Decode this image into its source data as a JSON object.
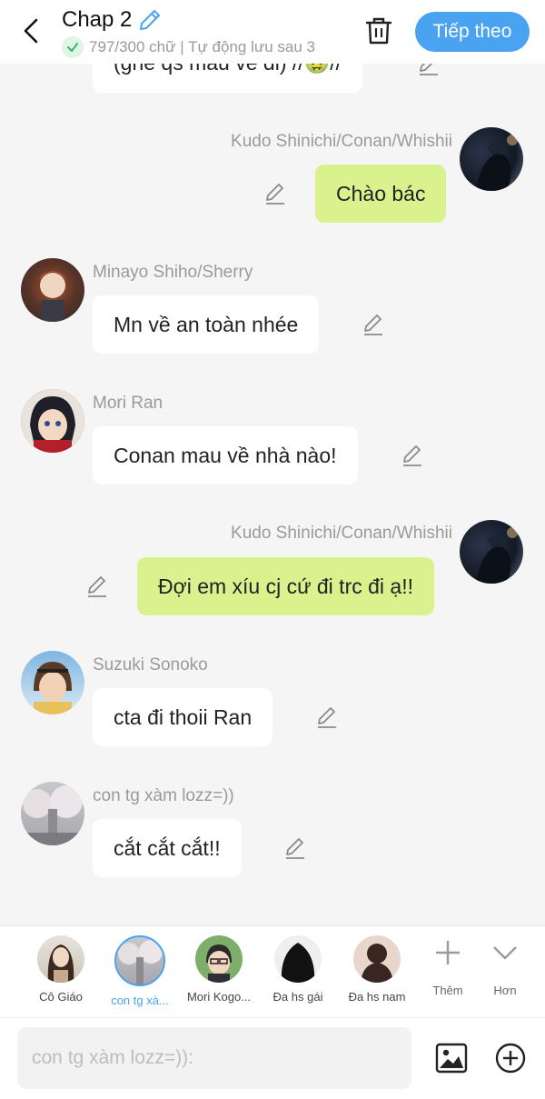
{
  "header": {
    "title": "Chap 2",
    "subtitle": "797/300 chữ | Tự động lưu sau 3",
    "next_label": "Tiếp theo"
  },
  "messages": [
    {
      "text": "(ghé qs mau về đi) //🤢//"
    },
    {
      "name": "Kudo Shinichi/Conan/Whishii",
      "text": "Chào bác"
    },
    {
      "name": "Minayo Shiho/Sherry",
      "text": "Mn về an toàn nhée"
    },
    {
      "name": "Mori Ran",
      "text": "Conan mau về nhà nào!"
    },
    {
      "name": "Kudo Shinichi/Conan/Whishii",
      "text": "Đợi em xíu cj cứ đi trc đi ạ!!"
    },
    {
      "name": "Suzuki Sonoko",
      "text": "cta đi thoii Ran"
    },
    {
      "name": "con tg xàm lozz=))",
      "text": "cắt cắt cắt!!"
    }
  ],
  "characters": [
    {
      "label": "Cô Giáo"
    },
    {
      "label": "con tg xà..."
    },
    {
      "label": "Mori Kogo..."
    },
    {
      "label": "Đa hs gái"
    },
    {
      "label": "Đa hs nam"
    }
  ],
  "tools": {
    "more_label": "Thêm",
    "expand_label": "Hơn"
  },
  "input": {
    "placeholder": "con tg xàm lozz=)):"
  },
  "colors": {
    "accent": "#4aa3f0",
    "my_bubble": "#d9f28d",
    "other_bubble": "#ffffff"
  }
}
